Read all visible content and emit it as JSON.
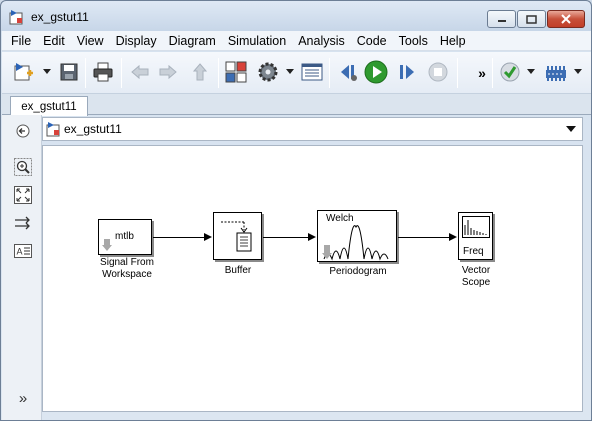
{
  "window": {
    "title": "ex_gstut11"
  },
  "menu": [
    "File",
    "Edit",
    "View",
    "Display",
    "Diagram",
    "Simulation",
    "Analysis",
    "Code",
    "Tools",
    "Help"
  ],
  "toolbar": {
    "overflow": "»"
  },
  "tabs": [
    {
      "label": "ex_gstut11"
    }
  ],
  "address": {
    "path": "ex_gstut11"
  },
  "palette": {
    "expand": "»"
  },
  "blocks": {
    "signal_from_workspace": {
      "text": "mtlb",
      "label_line1": "Signal From",
      "label_line2": "Workspace"
    },
    "buffer": {
      "label": "Buffer"
    },
    "periodogram": {
      "text": "Welch",
      "label": "Periodogram"
    },
    "vector_scope": {
      "text": "Freq",
      "label_line1": "Vector",
      "label_line2": "Scope"
    }
  },
  "colors": {
    "run_green": "#2f9a2f",
    "accent_blue": "#3c6db3",
    "close_red": "#c13e28"
  }
}
